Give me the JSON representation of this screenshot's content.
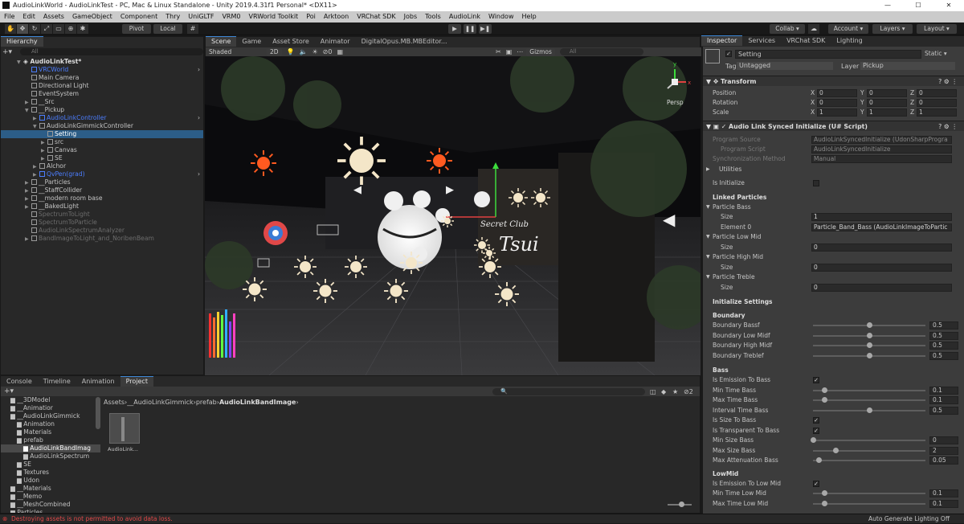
{
  "window": {
    "title": "AudioLinkWorld - AudioLinkTest - PC, Mac & Linux Standalone - Unity 2019.4.31f1 Personal* <DX11>",
    "min": "—",
    "max": "☐",
    "close": "✕"
  },
  "menu": [
    "File",
    "Edit",
    "Assets",
    "GameObject",
    "Component",
    "Thry",
    "UniGLTF",
    "VRM0",
    "VRWorld Toolkit",
    "Poi",
    "Arktoon",
    "VRChat SDK",
    "Jobs",
    "Tools",
    "AudioLink",
    "Window",
    "Help"
  ],
  "toolbar": {
    "pivot": "Pivot",
    "local": "Local",
    "collab": "Collab ▾",
    "account": "Account ▾",
    "layers": "Layers ▾",
    "layout": "Layout ▾",
    "play": "▶",
    "pause": "❚❚",
    "step": "▶❚"
  },
  "hierarchy": {
    "tab": "Hierarchy",
    "search": "All",
    "scene": "AudioLinkTest*",
    "rows": [
      {
        "label": "VRCWorld",
        "indent": 1,
        "style": "blue",
        "arrow": ""
      },
      {
        "label": "Main Camera",
        "indent": 1,
        "style": "",
        "arrow": ""
      },
      {
        "label": "Directional Light",
        "indent": 1,
        "style": "",
        "arrow": ""
      },
      {
        "label": "EventSystem",
        "indent": 1,
        "style": "",
        "arrow": ""
      },
      {
        "label": "__Src",
        "indent": 1,
        "style": "",
        "arrow": "▶"
      },
      {
        "label": "__Pickup",
        "indent": 1,
        "style": "",
        "arrow": "▼"
      },
      {
        "label": "AudioLinkController",
        "indent": 2,
        "style": "blue",
        "arrow": "▶"
      },
      {
        "label": "AudioLinkGimmickController",
        "indent": 2,
        "style": "",
        "arrow": "▼"
      },
      {
        "label": "Setting",
        "indent": 3,
        "style": "sel",
        "arrow": ""
      },
      {
        "label": "src",
        "indent": 3,
        "style": "",
        "arrow": "▶"
      },
      {
        "label": "Canvas",
        "indent": 3,
        "style": "",
        "arrow": "▶"
      },
      {
        "label": "SE",
        "indent": 3,
        "style": "",
        "arrow": "▶"
      },
      {
        "label": "Alchor",
        "indent": 2,
        "style": "",
        "arrow": "▶"
      },
      {
        "label": "QvPen(grad)",
        "indent": 2,
        "style": "blue",
        "arrow": "▶"
      },
      {
        "label": "__Particles",
        "indent": 1,
        "style": "",
        "arrow": "▶"
      },
      {
        "label": "__StaffCollider",
        "indent": 1,
        "style": "",
        "arrow": "▶"
      },
      {
        "label": "__modern room base",
        "indent": 1,
        "style": "",
        "arrow": "▶"
      },
      {
        "label": "__BakedLight",
        "indent": 1,
        "style": "",
        "arrow": "▶"
      },
      {
        "label": "SpectrumToLight",
        "indent": 1,
        "style": "dim",
        "arrow": ""
      },
      {
        "label": "SpectrumToParticle",
        "indent": 1,
        "style": "dim",
        "arrow": ""
      },
      {
        "label": "AudioLinkSpectrumAnalyzer",
        "indent": 1,
        "style": "dim",
        "arrow": ""
      },
      {
        "label": "BandImageToLight_and_NoribenBeam",
        "indent": 1,
        "style": "dim",
        "arrow": "▶"
      }
    ]
  },
  "scene": {
    "tabs": [
      "Scene",
      "Game",
      "Asset Store",
      "Animator",
      "DigitalOpus.MB.MBEditor..."
    ],
    "shaded": "Shaded",
    "mode2d": "2D",
    "gizmos": "Gizmos",
    "search": "All",
    "persp": "Persp",
    "zero": "0",
    "sign_line1": "Secret Club",
    "sign_line2": "Tsui"
  },
  "project": {
    "tabs": [
      "Console",
      "Timeline",
      "Animation",
      "Project"
    ],
    "breadcrumb": [
      "Assets",
      "__AudioLinkGimmick",
      "prefab",
      "AudioLinkBandImage"
    ],
    "count": "2",
    "tree": [
      {
        "label": "__3DModel",
        "indent": 1
      },
      {
        "label": "__Animatior",
        "indent": 1
      },
      {
        "label": "__AudioLinkGimmick",
        "indent": 1
      },
      {
        "label": "Animation",
        "indent": 2
      },
      {
        "label": "Materials",
        "indent": 2
      },
      {
        "label": "prefab",
        "indent": 2
      },
      {
        "label": "AudioLinkBandImag",
        "indent": 3,
        "sel": true
      },
      {
        "label": "AudioLinkSpectrum",
        "indent": 3
      },
      {
        "label": "SE",
        "indent": 2
      },
      {
        "label": "Textures",
        "indent": 2
      },
      {
        "label": "Udon",
        "indent": 2
      },
      {
        "label": "__Materials",
        "indent": 1
      },
      {
        "label": "__Memo",
        "indent": 1
      },
      {
        "label": "__MeshCombined",
        "indent": 1
      },
      {
        "label": "Particles",
        "indent": 1
      }
    ],
    "asset": "AudioLink..."
  },
  "inspector": {
    "tabs": [
      "Inspector",
      "Services",
      "VRChat SDK",
      "Lighting"
    ],
    "object_name": "Setting",
    "static": "Static ▾",
    "tag_label": "Tag",
    "tag": "Untagged",
    "layer_label": "Layer",
    "layer": "Pickup",
    "transform": {
      "title": "Transform",
      "position_label": "Position",
      "rotation_label": "Rotation",
      "scale_label": "Scale",
      "position": [
        "0",
        "0",
        "0"
      ],
      "rotation": [
        "0",
        "0",
        "0"
      ],
      "scale": [
        "1",
        "1",
        "1"
      ]
    },
    "script": {
      "title": "Audio Link Synced Initialize (U# Script)",
      "program_source_label": "Program Source",
      "program_source": "AudioLinkSyncedInitialize (UdonSharpProgra",
      "program_script_label": "Program Script",
      "program_script": "AudioLinkSyncedInitialize",
      "sync_label": "Synchronization Method",
      "sync": "Manual",
      "utilities": "Utilities",
      "is_initialize": "Is Initialize",
      "linked": "Linked Particles",
      "particle_bass": "Particle Bass",
      "size": "Size",
      "size_bass": "1",
      "element0": "Element 0",
      "element0_val": "Particle_Band_Bass (AudioLinkImageToPartic",
      "particle_low_mid": "Particle Low Mid",
      "size_low_mid": "0",
      "particle_high_mid": "Particle High Mid",
      "size_high_mid": "0",
      "particle_treble": "Particle Treble",
      "size_treble": "0",
      "init_settings": "Initialize Settings",
      "boundary": "Boundary",
      "boundary_rows": [
        {
          "label": "Boundary Bassf",
          "value": 0.5,
          "text": "0.5"
        },
        {
          "label": "Boundary Low Midf",
          "value": 0.5,
          "text": "0.5"
        },
        {
          "label": "Boundary High Midf",
          "value": 0.5,
          "text": "0.5"
        },
        {
          "label": "Boundary Treblef",
          "value": 0.5,
          "text": "0.5"
        }
      ],
      "bass": "Bass",
      "bass_rows": [
        {
          "label": "Is Emission To Bass",
          "check": true
        },
        {
          "label": "Min Time Bass",
          "value": 0.1,
          "text": "0.1"
        },
        {
          "label": "Max Time Bass",
          "value": 0.1,
          "text": "0.1"
        },
        {
          "label": "Interval Time Bass",
          "value": 0.5,
          "text": "0.5"
        },
        {
          "label": "Is Size To Bass",
          "check": true
        },
        {
          "label": "Is Transparent To Bass",
          "check": true
        },
        {
          "label": "Min Size Bass",
          "value": 0,
          "text": "0"
        },
        {
          "label": "Max Size Bass",
          "value": 0.2,
          "text": "2"
        },
        {
          "label": "Max Attenuation Bass",
          "value": 0.05,
          "text": "0.05"
        }
      ],
      "lowmid": "LowMid",
      "lowmid_rows": [
        {
          "label": "Is Emission To Low Mid",
          "check": true
        },
        {
          "label": "Min Time Low Mid",
          "value": 0.1,
          "text": "0.1"
        },
        {
          "label": "Max Time Low Mid",
          "value": 0.1,
          "text": "0.1"
        }
      ]
    }
  },
  "status": {
    "error": "Destroying assets is not permitted to avoid data loss.",
    "right": "Auto Generate Lighting Off"
  }
}
